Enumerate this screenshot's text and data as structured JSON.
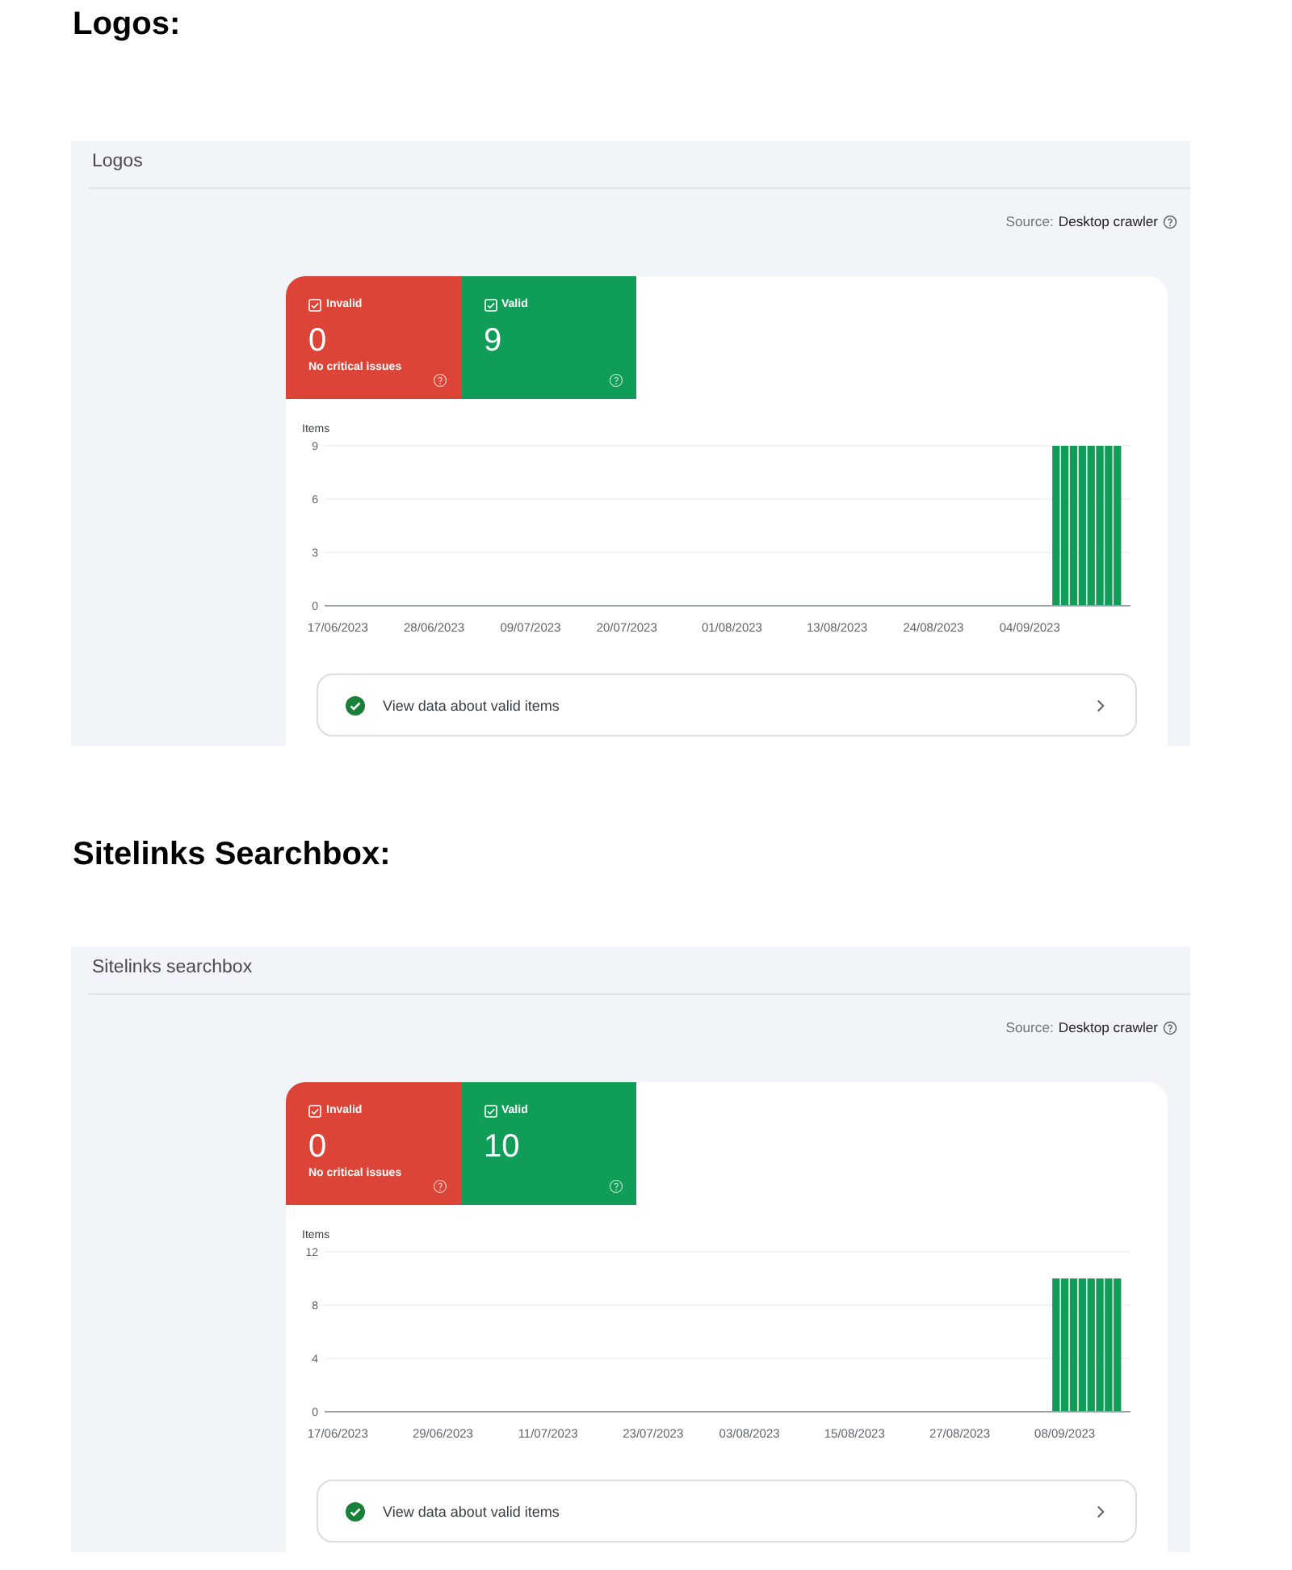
{
  "sections": [
    {
      "heading": "Logos:",
      "panel": {
        "title": "Logos",
        "source": {
          "label": "Source:",
          "value": "Desktop crawler"
        },
        "tiles": [
          {
            "label": "Invalid",
            "checked": true,
            "count": "0",
            "note": "No critical issues",
            "color": "#db4437"
          },
          {
            "label": "Valid",
            "checked": true,
            "count": "9",
            "color": "#0f9d58"
          }
        ],
        "chart_data": {
          "type": "bar",
          "ylabel": "Items",
          "ylim": [
            0,
            9
          ],
          "yticks": [
            0,
            3,
            6,
            9
          ],
          "categories": [
            "17/06/2023",
            null,
            null,
            null,
            null,
            null,
            null,
            null,
            null,
            null,
            null,
            "28/06/2023",
            null,
            null,
            null,
            null,
            null,
            null,
            null,
            null,
            null,
            null,
            "09/07/2023",
            null,
            null,
            null,
            null,
            null,
            null,
            null,
            null,
            null,
            null,
            "20/07/2023",
            null,
            null,
            null,
            null,
            null,
            null,
            null,
            null,
            null,
            null,
            null,
            "01/08/2023",
            null,
            null,
            null,
            null,
            null,
            null,
            null,
            null,
            null,
            null,
            null,
            "13/08/2023",
            null,
            null,
            null,
            null,
            null,
            null,
            null,
            null,
            null,
            null,
            "24/08/2023",
            null,
            null,
            null,
            null,
            null,
            null,
            null,
            null,
            null,
            null,
            "04/09/2023",
            null,
            null,
            null,
            null,
            null,
            null,
            null,
            null,
            null,
            null
          ],
          "values": [
            null,
            null,
            null,
            null,
            null,
            null,
            null,
            null,
            null,
            null,
            null,
            null,
            null,
            null,
            null,
            null,
            null,
            null,
            null,
            null,
            null,
            null,
            null,
            null,
            null,
            null,
            null,
            null,
            null,
            null,
            null,
            null,
            null,
            null,
            null,
            null,
            null,
            null,
            null,
            null,
            null,
            null,
            null,
            null,
            null,
            null,
            null,
            null,
            null,
            null,
            null,
            null,
            null,
            null,
            null,
            null,
            null,
            null,
            null,
            null,
            null,
            null,
            null,
            null,
            null,
            null,
            null,
            null,
            null,
            null,
            null,
            null,
            null,
            null,
            null,
            null,
            null,
            null,
            null,
            null,
            null,
            null,
            9,
            9,
            9,
            9,
            9,
            9,
            9,
            9
          ]
        },
        "link": {
          "label": "View data about valid items"
        }
      }
    },
    {
      "heading": "Sitelinks Searchbox:",
      "panel": {
        "title": "Sitelinks searchbox",
        "source": {
          "label": "Source:",
          "value": "Desktop crawler"
        },
        "tiles": [
          {
            "label": "Invalid",
            "checked": true,
            "count": "0",
            "note": "No critical issues",
            "color": "#db4437"
          },
          {
            "label": "Valid",
            "checked": true,
            "count": "10",
            "color": "#0f9d58"
          }
        ],
        "chart_data": {
          "type": "bar",
          "ylabel": "Items",
          "ylim": [
            0,
            12
          ],
          "yticks": [
            0,
            4,
            8,
            12
          ],
          "categories": [
            "17/06/2023",
            null,
            null,
            null,
            null,
            null,
            null,
            null,
            null,
            null,
            null,
            null,
            "29/06/2023",
            null,
            null,
            null,
            null,
            null,
            null,
            null,
            null,
            null,
            null,
            null,
            "11/07/2023",
            null,
            null,
            null,
            null,
            null,
            null,
            null,
            null,
            null,
            null,
            null,
            "23/07/2023",
            null,
            null,
            null,
            null,
            null,
            null,
            null,
            null,
            null,
            null,
            "03/08/2023",
            null,
            null,
            null,
            null,
            null,
            null,
            null,
            null,
            null,
            null,
            null,
            "15/08/2023",
            null,
            null,
            null,
            null,
            null,
            null,
            null,
            null,
            null,
            null,
            null,
            "27/08/2023",
            null,
            null,
            null,
            null,
            null,
            null,
            null,
            null,
            null,
            null,
            null,
            "08/09/2023",
            null,
            null,
            null,
            null,
            null,
            null
          ],
          "values": [
            null,
            null,
            null,
            null,
            null,
            null,
            null,
            null,
            null,
            null,
            null,
            null,
            null,
            null,
            null,
            null,
            null,
            null,
            null,
            null,
            null,
            null,
            null,
            null,
            null,
            null,
            null,
            null,
            null,
            null,
            null,
            null,
            null,
            null,
            null,
            null,
            null,
            null,
            null,
            null,
            null,
            null,
            null,
            null,
            null,
            null,
            null,
            null,
            null,
            null,
            null,
            null,
            null,
            null,
            null,
            null,
            null,
            null,
            null,
            null,
            null,
            null,
            null,
            null,
            null,
            null,
            null,
            null,
            null,
            null,
            null,
            null,
            null,
            null,
            null,
            null,
            null,
            null,
            null,
            null,
            null,
            null,
            10,
            10,
            10,
            10,
            10,
            10,
            10,
            10
          ]
        },
        "link": {
          "label": "View data about valid items"
        }
      }
    }
  ]
}
